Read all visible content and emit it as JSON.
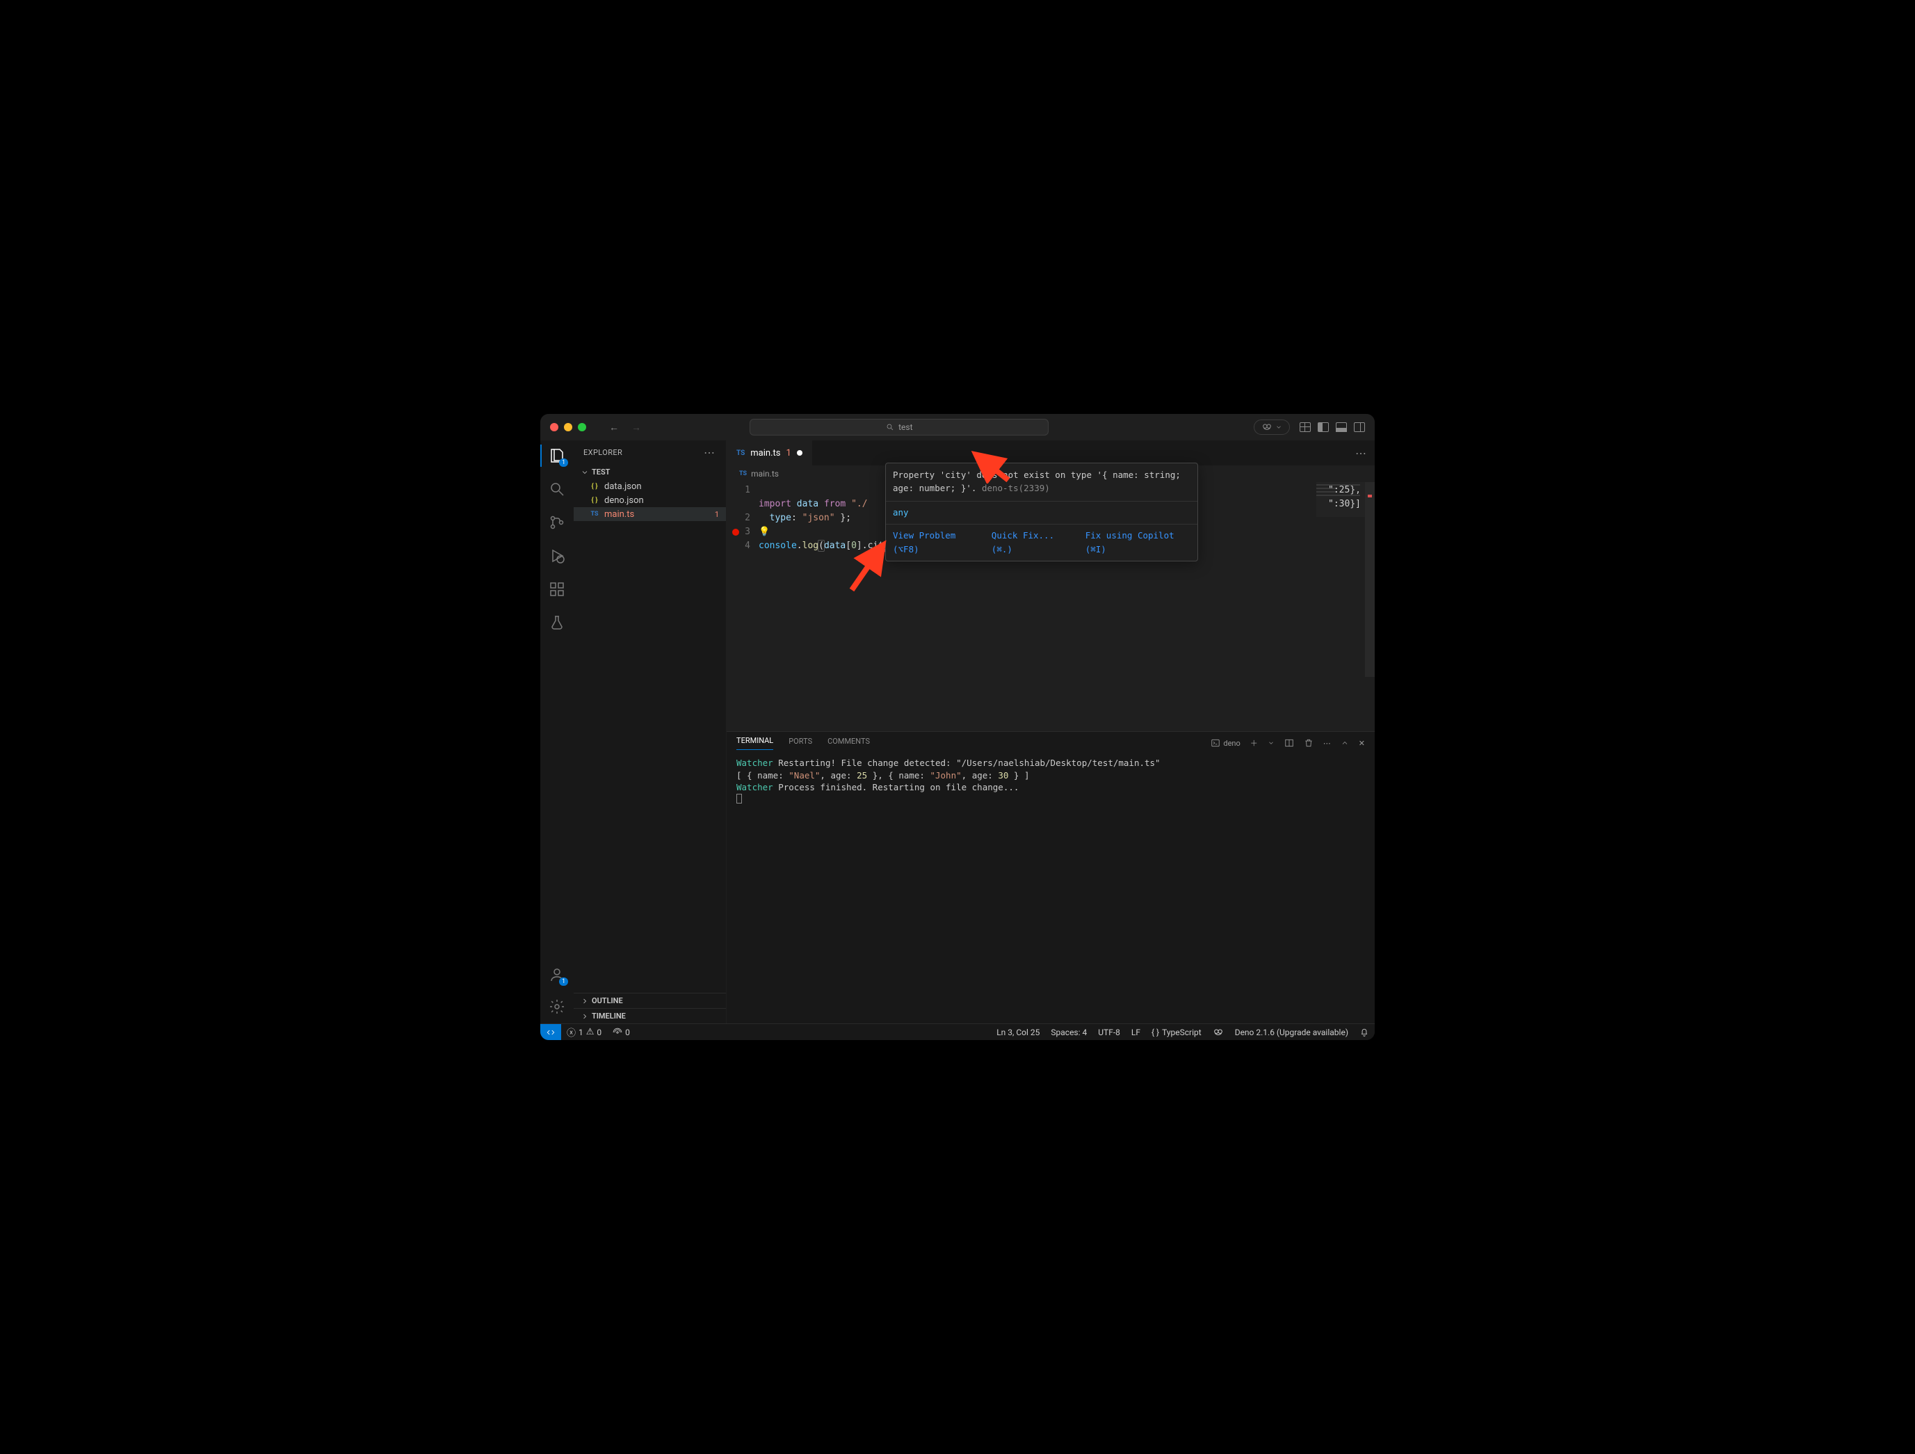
{
  "window": {
    "search_text": "test"
  },
  "explorer": {
    "title": "EXPLORER",
    "folder": "TEST",
    "files": [
      {
        "name": "data.json",
        "icon": "{ }"
      },
      {
        "name": "deno.json",
        "icon": "{ }"
      },
      {
        "name": "main.ts",
        "icon": "TS",
        "error_count": "1",
        "selected": true
      }
    ],
    "outline": "OUTLINE",
    "timeline": "TIMELINE"
  },
  "tab": {
    "filename": "main.ts",
    "modified": "1"
  },
  "breadcrumb": {
    "filename": "main.ts"
  },
  "code": {
    "line3_err_word": "city",
    "data_preview_1": "\":25},",
    "data_preview_2": "\":30}]"
  },
  "hover": {
    "msg1": "Property 'city' does not exist on type '{ name: string;",
    "msg2": "age: number; }'.",
    "src": " deno-ts(2339)",
    "type": "any",
    "action_view": "View Problem (⌥F8)",
    "action_fix": "Quick Fix... (⌘.)",
    "action_copilot": "Fix using Copilot (⌘I)"
  },
  "panel": {
    "tabs": {
      "terminal": "TERMINAL",
      "ports": "PORTS",
      "comments": "COMMENTS"
    },
    "shell": "deno",
    "term1_a": "Watcher",
    "term1_b": " Restarting! File change detected: \"/Users/naelshiab/Desktop/test/main.ts\"",
    "term2_pre": "[ { name: ",
    "term2_s1": "\"Nael\"",
    "term2_mid1": ", age: ",
    "term2_n1": "25",
    "term2_mid2": " }, { name: ",
    "term2_s2": "\"John\"",
    "term2_mid3": ", age: ",
    "term2_n2": "30",
    "term2_end": " } ]",
    "term3_a": "Watcher",
    "term3_b": " Process finished. Restarting on file change..."
  },
  "status": {
    "errors": "1",
    "warnings": "0",
    "ports": "0",
    "cursor": "Ln 3, Col 25",
    "spaces": "Spaces: 4",
    "encoding": "UTF-8",
    "eol": "LF",
    "lang": "TypeScript",
    "deno": "Deno 2.1.6 (Upgrade available)"
  }
}
